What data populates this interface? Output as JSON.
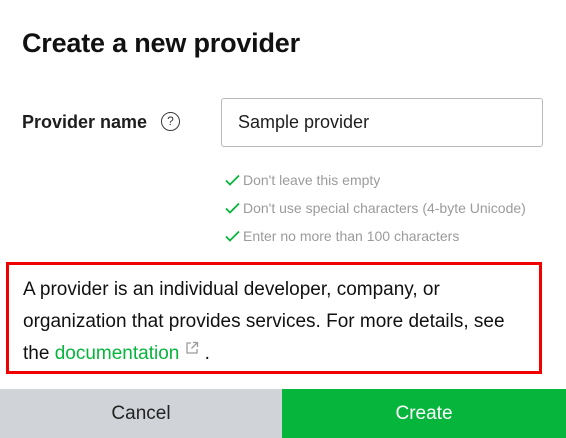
{
  "dialog": {
    "title": "Create a new provider"
  },
  "form": {
    "label": "Provider name",
    "help_icon": "?",
    "input_value": "Sample provider",
    "rules": [
      "Don't leave this empty",
      "Don't use special characters (4-byte Unicode)",
      "Enter no more than 100 characters"
    ]
  },
  "info": {
    "line1": "A provider is an individual developer, company, or",
    "line2": "organization that provides services. For more details, see",
    "line3_prefix": "the ",
    "link_text": "documentation",
    "line3_suffix": " ."
  },
  "footer": {
    "cancel_label": "Cancel",
    "create_label": "Create"
  },
  "colors": {
    "accent": "#06b53c",
    "highlight_border": "#f10000",
    "cancel_bg": "#d0d4d9"
  },
  "icons": {
    "help": "help-circle-icon",
    "check": "check-icon",
    "external": "external-link-icon"
  }
}
